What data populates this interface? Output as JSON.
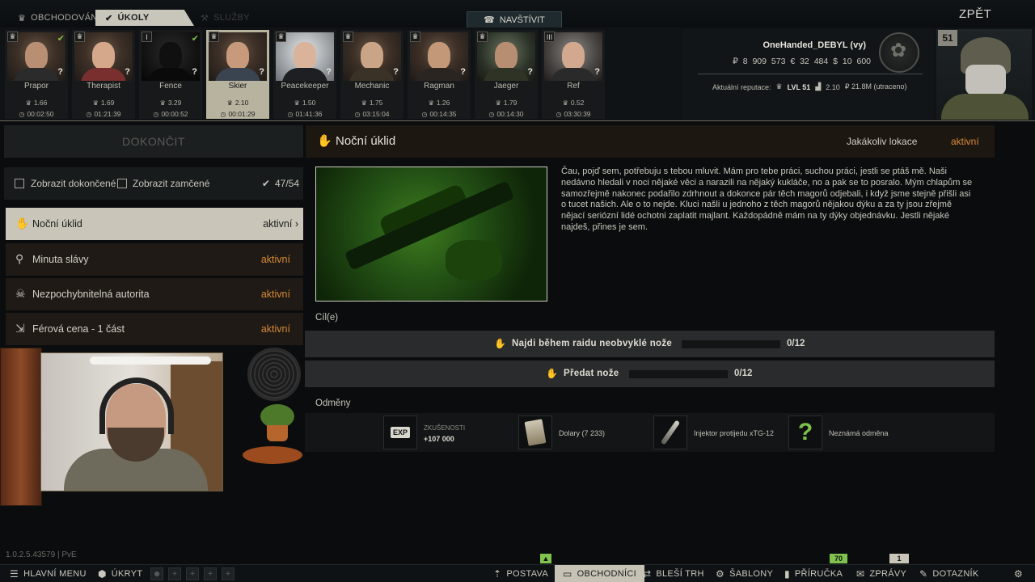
{
  "nav": {
    "tabs": [
      {
        "label": "OBCHODOVÁNÍ",
        "icon": "crown-icon"
      },
      {
        "label": "ÚKOLY",
        "icon": "check-circle-icon"
      },
      {
        "label": "SLUŽBY",
        "icon": "wrench-icon"
      }
    ],
    "visit_label": "NAVŠTÍVIT",
    "back_label": "ZPĚT"
  },
  "traders": [
    {
      "name": "Prapor",
      "loyalty": "♛",
      "rep": "1.66",
      "timer": "00:02:50",
      "quest_done": true
    },
    {
      "name": "Therapist",
      "loyalty": "♛",
      "rep": "1.69",
      "timer": "01:21:39",
      "quest_done": false
    },
    {
      "name": "Fence",
      "loyalty": "I",
      "rep": "3.29",
      "timer": "00:00:52",
      "quest_done": true
    },
    {
      "name": "Skier",
      "loyalty": "♛",
      "rep": "2.10",
      "timer": "00:01:29",
      "quest_done": false,
      "selected": true
    },
    {
      "name": "Peacekeeper",
      "loyalty": "♛",
      "rep": "1.50",
      "timer": "01:41:36",
      "quest_done": false
    },
    {
      "name": "Mechanic",
      "loyalty": "♛",
      "rep": "1.75",
      "timer": "03:15:04",
      "quest_done": false
    },
    {
      "name": "Ragman",
      "loyalty": "♛",
      "rep": "1.26",
      "timer": "00:14:35",
      "quest_done": false
    },
    {
      "name": "Jaeger",
      "loyalty": "♛",
      "rep": "1.79",
      "timer": "00:14:30",
      "quest_done": false
    },
    {
      "name": "Ref",
      "loyalty": "III",
      "rep": "0.52",
      "timer": "03:30:39",
      "quest_done": false
    }
  ],
  "profile": {
    "name": "OneHanded_DEBYL (vy)",
    "money": "₽ 8 909 573   € 32 484   $ 10 600",
    "rep_label": "Aktuální reputace:",
    "level": "LVL 51",
    "standing": "2.10",
    "spent": "₽ 21.8M (utraceno)",
    "level_badge": "51"
  },
  "left": {
    "finish_label": "DOKONČIT",
    "show_completed": "Zobrazit dokončené",
    "show_locked": "Zobrazit zamčené",
    "quest_count": "47/54",
    "quests": [
      {
        "name": "Noční úklid",
        "status": "aktivní",
        "icon": "hand-icon",
        "selected": true
      },
      {
        "name": "Minuta slávy",
        "status": "aktivní",
        "icon": "map-pin-icon"
      },
      {
        "name": "Nezpochybnitelná autorita",
        "status": "aktivní",
        "icon": "skull-icon"
      },
      {
        "name": "Férová cena - 1 část",
        "status": "aktivní",
        "icon": "exit-icon"
      }
    ]
  },
  "quest": {
    "title": "Noční úklid",
    "location": "Jakákoliv lokace",
    "status": "aktivní",
    "description": "Čau, pojď sem, potřebuju s tebou mluvit. Mám pro tebe práci, suchou práci, jestli se ptáš mě. Naši nedávno hledali v noci nějaké věci a narazili na nějaký kukláče, no a pak se to posralo. Mým chlapům se samozřejmě nakonec podařilo zdrhnout a dokonce pár těch magorů odjebali, i když jsme stejně přišli asi o tucet našich. Ale o to nejde. Kluci našli u jednoho z těch magorů nějakou dýku a za ty jsou zřejmě nějací seriózní lidé ochotni zaplatit majlant. Každopádně mám na ty dýky objednávku. Jestli nějaké najdeš, přines je sem.",
    "objectives_label": "Cíl(e)",
    "objectives": [
      {
        "text": "Najdi během raidu neobvyklé nože",
        "progress": "0/12",
        "fraction": 0
      },
      {
        "text": "Předat nože",
        "progress": "0/12",
        "fraction": 0
      }
    ],
    "rewards_label": "Odměny",
    "rewards": [
      {
        "label1": "ZKUŠENOSTI",
        "label2": "+107 000",
        "icon": "exp-icon"
      },
      {
        "label1": "Dolary (7 233)",
        "label2": "",
        "icon": "dollar-bills-icon"
      },
      {
        "label1": "Injektor protijedu xTG-12",
        "label2": "",
        "icon": "injector-icon"
      },
      {
        "label1": "Neznámá odměna",
        "label2": "",
        "icon": "question-icon"
      }
    ]
  },
  "footer": {
    "version": "1.0.2.5.43579 | PvE",
    "main_menu": "HLAVNÍ MENU",
    "hideout": "ÚKRYT",
    "character": "POSTAVA",
    "traders": "OBCHODNÍCI",
    "flea": "BLEŠÍ TRH",
    "templates": "ŠABLONY",
    "handbook": "PŘÍRUČKA",
    "messages": "ZPRÁVY",
    "survey": "DOTAZNÍK",
    "badge_handbook": "70",
    "badge_messages": "1"
  },
  "colors": {
    "accent_orange": "#d88a34",
    "selected_bg": "#c9c6b9",
    "badge_green": "#7fc24d"
  }
}
